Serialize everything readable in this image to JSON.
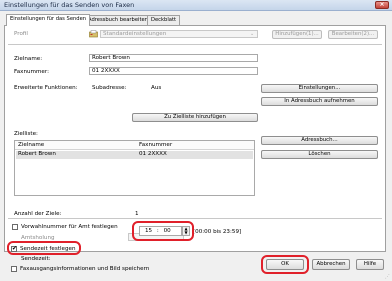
{
  "window": {
    "title": "Einstellungen für das Senden von Faxen",
    "close_glyph": "×"
  },
  "tabs": [
    {
      "label": "Einstellungen für das Senden"
    },
    {
      "label": "Adressbuch bearbeiten"
    },
    {
      "label": "Deckblatt"
    }
  ],
  "profile": {
    "label": "Profil",
    "value": "Standardeinstellungen",
    "add_label": "Hinzufügen(1)...",
    "edit_label": "Bearbeiten(2)..."
  },
  "recipient": {
    "name_label": "Zielname:",
    "name_value": "Robert Brown",
    "fax_label": "Faxnummer:",
    "fax_value": "01 2XXXX",
    "ext_label": "Erweiterte Funktionen:",
    "subaddr_label": "Subadresse:",
    "subaddr_value": "Aus",
    "settings_button": "Einstellungen...",
    "add_to_book_button": "In Adressbuch aufnehmen",
    "add_to_list_button": "Zu Zielliste hinzufügen"
  },
  "dest_list": {
    "label": "Zielliste:",
    "col_name": "Zielname",
    "col_fax": "Faxnummer",
    "rows": [
      {
        "name": "Robert Brown",
        "fax": "01 2XXXX"
      }
    ],
    "address_book_button": "Adressbuch...",
    "delete_button": "Löschen",
    "count_label": "Anzahl der Ziele:",
    "count_value": "1"
  },
  "options": {
    "outside_prefix_label": "Vorwahlnummer für Amt festlegen",
    "dial_label": "Amtsholung",
    "send_time_label": "Sendezeit festlegen",
    "send_time_sub_label": "Sendezeit:",
    "hour": "15",
    "colon": ":",
    "minute": "00",
    "range_hint": "[00:00 bis 23:59]",
    "save_label": "Faxausgangsinformationen und Bild speichern"
  },
  "footer": {
    "ok_label": "OK",
    "cancel_label": "Abbrechen",
    "help_label": "Hilfe"
  }
}
